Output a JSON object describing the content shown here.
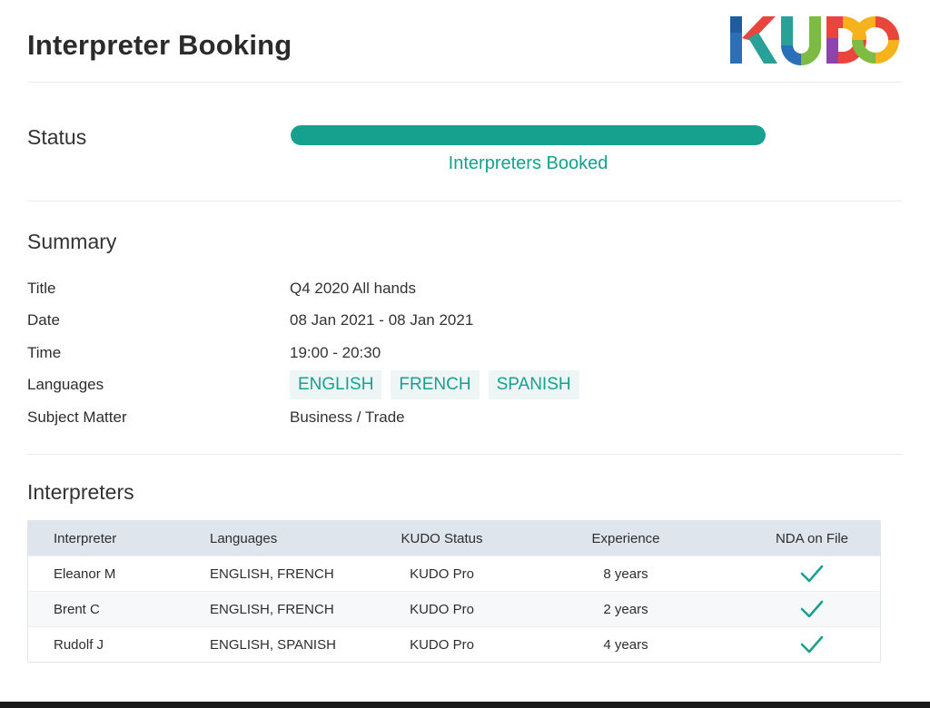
{
  "header": {
    "title": "Interpreter Booking",
    "logo_text": "KUDO",
    "logo_colors": [
      "#2a6fb8",
      "#2aa198",
      "#e8453c",
      "#f5b21a",
      "#7dbb42",
      "#8e44ad"
    ]
  },
  "status": {
    "label": "Status",
    "progress_fraction": 1.0,
    "text": "Interpreters Booked",
    "accent_color": "#16a08e"
  },
  "summary": {
    "heading": "Summary",
    "rows": {
      "title": {
        "label": "Title",
        "value": "Q4 2020 All hands"
      },
      "date": {
        "label": "Date",
        "value": "08 Jan 2021 - 08 Jan 2021"
      },
      "time": {
        "label": "Time",
        "value": "19:00 - 20:30"
      },
      "languages": {
        "label": "Languages",
        "values": [
          "ENGLISH",
          "FRENCH",
          "SPANISH"
        ]
      },
      "subject": {
        "label": "Subject Matter",
        "value": "Business / Trade"
      }
    }
  },
  "interpreters": {
    "heading": "Interpreters",
    "columns": [
      "Interpreter",
      "Languages",
      "KUDO Status",
      "Experience",
      "NDA on File"
    ],
    "rows": [
      {
        "name": "Eleanor M",
        "languages": "ENGLISH, FRENCH",
        "status": "KUDO Pro",
        "experience": "8 years",
        "nda_icon": "checkmark-icon"
      },
      {
        "name": "Brent C",
        "languages": "ENGLISH, FRENCH",
        "status": "KUDO Pro",
        "experience": "2 years",
        "nda_icon": "checkmark-icon"
      },
      {
        "name": "Rudolf J",
        "languages": "ENGLISH, SPANISH",
        "status": "KUDO Pro",
        "experience": "4 years",
        "nda_icon": "checkmark-icon"
      }
    ]
  }
}
